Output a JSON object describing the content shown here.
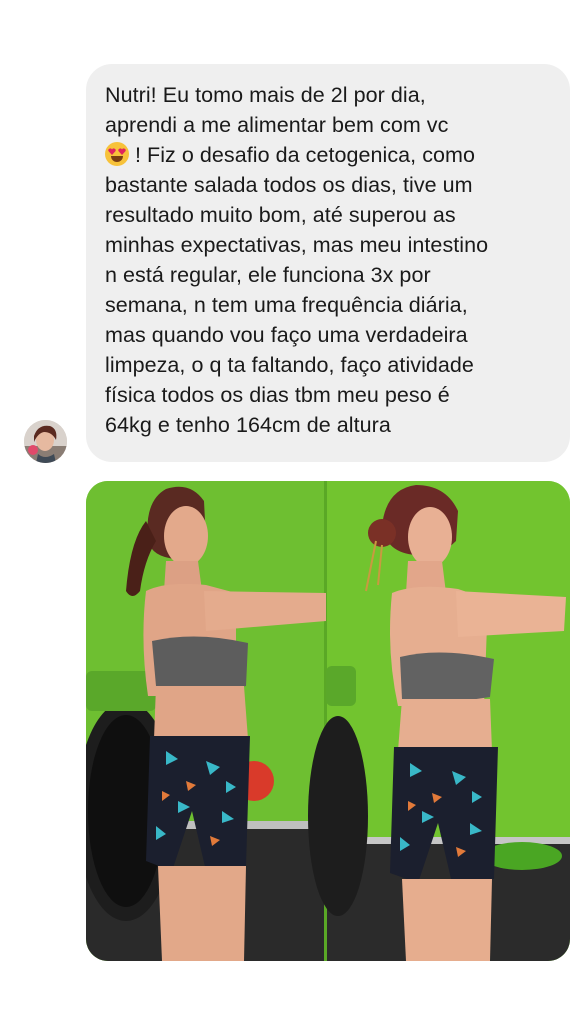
{
  "message": {
    "lines": [
      "Nutri! Eu tomo mais de 2l por dia,",
      "aprendi a me alimentar bem com vc",
      "! Fiz o desafio da cetogenica, como",
      "bastante salada todos os dias, tive um",
      "resultado muito bom, até superou as",
      "minhas expectativas, mas meu intestino",
      "n está regular, ele funciona 3x por",
      "semana, n tem uma frequência diária,",
      "mas quando vou faço uma verdadeira",
      "limpeza, o q ta faltando, faço atividade",
      "física todos os dias tbm meu peso é",
      "64kg e tenho 164cm de altura"
    ],
    "emoji_icon": "smiling-face-with-heart-eyes-icon",
    "bubble_color": "#efefef",
    "text_color": "#1a1a1a"
  },
  "photo": {
    "description_icon": "before-after-photo",
    "background_color": "#6fbf34"
  },
  "avatar": {
    "icon": "user-avatar"
  }
}
